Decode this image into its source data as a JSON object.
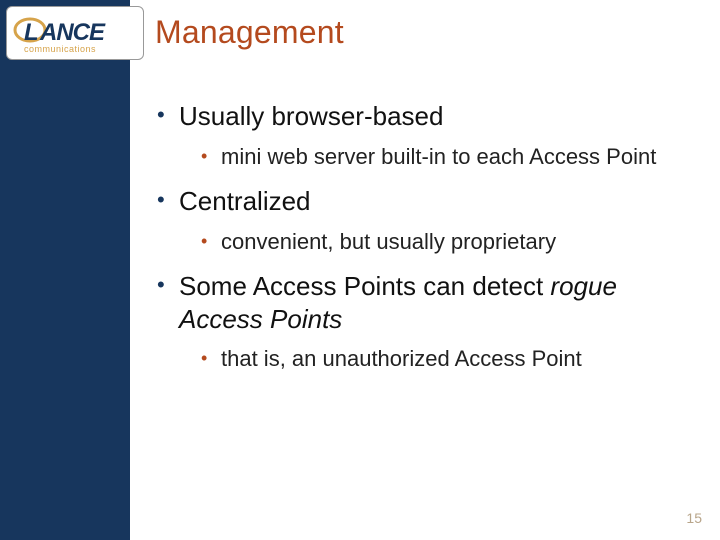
{
  "logo": {
    "brand_main": "LANCE",
    "brand_sub": "communications",
    "accent_color": "#d6a34a",
    "main_color": "#17365d"
  },
  "title": "Management",
  "bullets": [
    {
      "text": "Usually browser-based",
      "sub": [
        {
          "text": "mini web server built-in to each Access Point"
        }
      ]
    },
    {
      "text": "Centralized",
      "sub": [
        {
          "text": "convenient, but usually proprietary"
        }
      ]
    },
    {
      "text_prefix": "Some Access Points can detect ",
      "text_italic": "rogue Access Points",
      "sub": [
        {
          "text": "that is, an unauthorized Access Point"
        }
      ]
    }
  ],
  "page_number": "15",
  "colors": {
    "sidebar": "#17365d",
    "title": "#b44a1e",
    "sub_bullet": "#b44a1e"
  }
}
